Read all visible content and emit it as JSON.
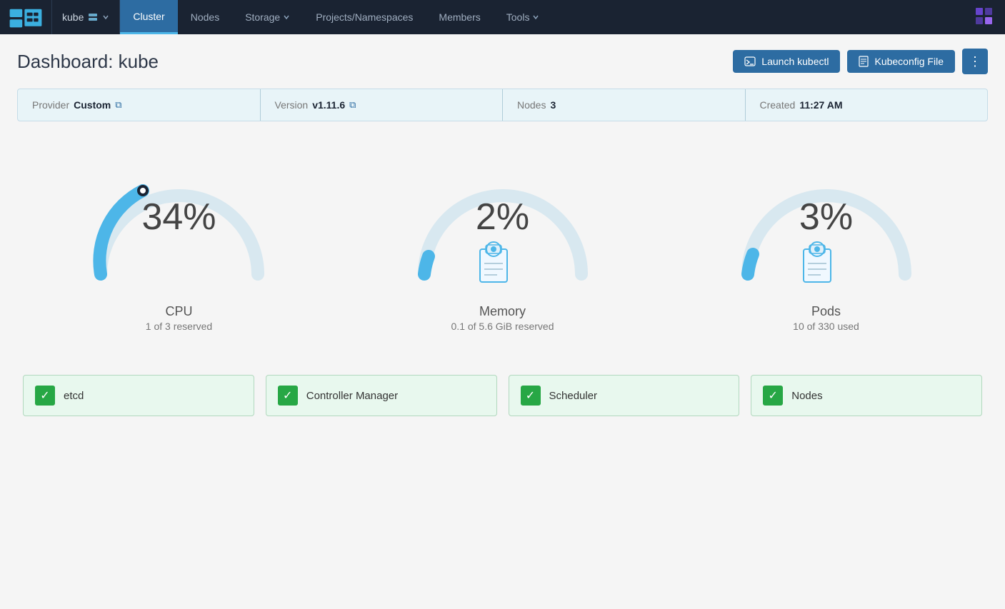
{
  "brand": {
    "name": "Rancher"
  },
  "kube_selector": {
    "label": "kube",
    "icon": "server-icon"
  },
  "nav": {
    "items": [
      {
        "id": "cluster",
        "label": "Cluster",
        "active": true,
        "hasDropdown": false
      },
      {
        "id": "nodes",
        "label": "Nodes",
        "active": false,
        "hasDropdown": false
      },
      {
        "id": "storage",
        "label": "Storage",
        "active": false,
        "hasDropdown": true
      },
      {
        "id": "projects",
        "label": "Projects/Namespaces",
        "active": false,
        "hasDropdown": false
      },
      {
        "id": "members",
        "label": "Members",
        "active": false,
        "hasDropdown": false
      },
      {
        "id": "tools",
        "label": "Tools",
        "active": false,
        "hasDropdown": true
      }
    ]
  },
  "page": {
    "title": "Dashboard: kube",
    "actions": {
      "launch_kubectl": "Launch kubectl",
      "kubeconfig_file": "Kubeconfig File",
      "more": "⋮"
    }
  },
  "info_bar": {
    "provider_label": "Provider",
    "provider_value": "Custom",
    "version_label": "Version",
    "version_value": "v1.11.6",
    "nodes_label": "Nodes",
    "nodes_value": "3",
    "created_label": "Created",
    "created_value": "11:27 AM"
  },
  "gauges": [
    {
      "id": "cpu",
      "percent": 34,
      "percent_display": "34%",
      "label": "CPU",
      "sublabel": "1 of 3 reserved",
      "color": "#4db6e8",
      "track_color": "#d8e8f0",
      "start_angle": -210,
      "end_angle": -30
    },
    {
      "id": "memory",
      "percent": 2,
      "percent_display": "2%",
      "label": "Memory",
      "sublabel": "0.1 of 5.6 GiB reserved",
      "color": "#4db6e8",
      "track_color": "#d8e8f0",
      "start_angle": -210,
      "end_angle": -30
    },
    {
      "id": "pods",
      "percent": 3,
      "percent_display": "3%",
      "label": "Pods",
      "sublabel": "10 of 330 used",
      "color": "#4db6e8",
      "track_color": "#d8e8f0",
      "start_angle": -210,
      "end_angle": -30
    }
  ],
  "status_cards": [
    {
      "id": "etcd",
      "label": "etcd",
      "status": "ok"
    },
    {
      "id": "controller-manager",
      "label": "Controller Manager",
      "status": "ok"
    },
    {
      "id": "scheduler",
      "label": "Scheduler",
      "status": "ok"
    },
    {
      "id": "nodes",
      "label": "Nodes",
      "status": "ok"
    }
  ]
}
